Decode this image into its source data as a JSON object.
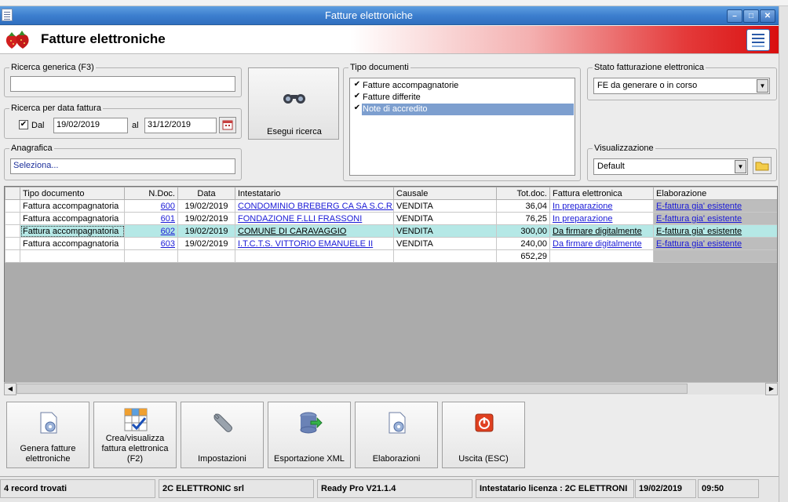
{
  "window": {
    "title": "Fatture elettroniche"
  },
  "header": {
    "title": "Fatture elettroniche"
  },
  "filters": {
    "ricerca_generica": {
      "label": "Ricerca generica (F3)",
      "value": ""
    },
    "ricerca_data": {
      "label": "Ricerca per data fattura",
      "dal_label": "Dal",
      "dal_checked": true,
      "dal_value": "19/02/2019",
      "al_label": "al",
      "al_value": "31/12/2019"
    },
    "anagrafica": {
      "label": "Anagrafica",
      "value": "Seleziona..."
    },
    "search_button_label": "Esegui ricerca",
    "tipo_documenti": {
      "label": "Tipo documenti",
      "items": [
        {
          "label": "Fatture accompagnatorie",
          "checked": true
        },
        {
          "label": "Fatture differite",
          "checked": true
        },
        {
          "label": "Note di accredito",
          "checked": true
        }
      ]
    },
    "stato": {
      "label": "Stato fatturazione elettronica",
      "value": "FE da generare o in corso"
    },
    "visualizzazione": {
      "label": "Visualizzazione",
      "value": "Default"
    }
  },
  "grid": {
    "columns": [
      "Tipo documento",
      "N.Doc.",
      "Data",
      "Intestatario",
      "Causale",
      "Tot.doc.",
      "Fattura elettronica",
      "Elaborazione"
    ],
    "rows": [
      {
        "tipo": "Fattura accompagnatoria",
        "ndoc": "600",
        "data": "19/02/2019",
        "intestatario": "CONDOMINIO BREBERG CA SA S.C.R.L.",
        "causale": "VENDITA",
        "tot": "36,04",
        "fe": "In preparazione",
        "elab": "E-fattura gia' esistente"
      },
      {
        "tipo": "Fattura accompagnatoria",
        "ndoc": "601",
        "data": "19/02/2019",
        "intestatario": "FONDAZIONE F.LLI FRASSONI",
        "causale": "VENDITA",
        "tot": "76,25",
        "fe": "In preparazione",
        "elab": "E-fattura gia' esistente"
      },
      {
        "tipo": "Fattura accompagnatoria",
        "ndoc": "602",
        "data": "19/02/2019",
        "intestatario": "COMUNE DI CARAVAGGIO",
        "causale": "VENDITA",
        "tot": "300,00",
        "fe": "Da firmare digitalmente",
        "elab": "E-fattura gia' esistente"
      },
      {
        "tipo": "Fattura accompagnatoria",
        "ndoc": "603",
        "data": "19/02/2019",
        "intestatario": "I.T.C.T.S. VITTORIO EMANUELE II",
        "causale": "VENDITA",
        "tot": "240,00",
        "fe": "Da firmare digitalmente",
        "elab": "E-fattura gia' esistente"
      }
    ],
    "total": "652,29",
    "selected_row": 2
  },
  "toolbar": {
    "genera_line1": "Genera fatture",
    "genera_line2": "elettroniche",
    "crea_line1": "Crea/visualizza",
    "crea_line2": "fattura elettronica",
    "crea_line3": "(F2)",
    "impostazioni": "Impostazioni",
    "esportazione": "Esportazione XML",
    "elaborazioni": "Elaborazioni",
    "uscita": "Uscita (ESC)"
  },
  "status": {
    "records": "4 record trovati",
    "company": "2C ELETTRONIC srl",
    "version": "Ready Pro V21.1.4",
    "licenza": "Intestatario licenza : 2C ELETTRONI",
    "date": "19/02/2019",
    "time": "09:50"
  },
  "colors": {
    "title_bar": "#3d7fcf",
    "selected_row": "#b5e8e6",
    "link": "#1a1ad6",
    "banner_red": "#d90f0f"
  }
}
